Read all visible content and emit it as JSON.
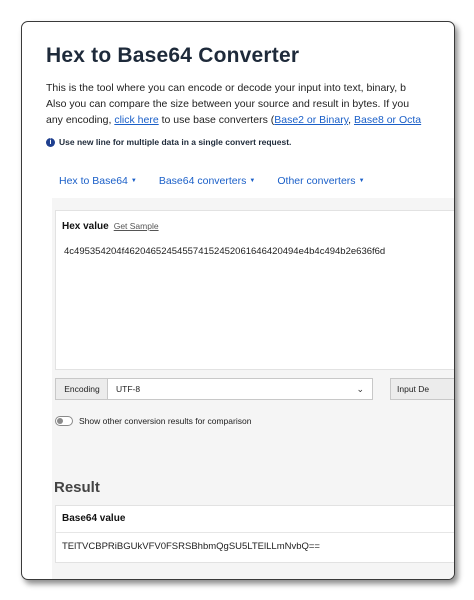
{
  "page": {
    "title": "Hex to Base64 Converter",
    "desc_line1": "This is the tool where you can encode or decode your input into text, binary, b",
    "desc_line2": "Also you can compare the size between your source and result in bytes. If you",
    "desc_line3_pre": "any encoding, ",
    "desc_link1": "click here",
    "desc_line3_mid": " to use base converters (",
    "desc_link2": "Base2 or Binary",
    "desc_sep": ", ",
    "desc_link3": "Base8 or Octa",
    "note": "Use new line for multiple data in a single convert request."
  },
  "nav": {
    "items": [
      "Hex to Base64",
      "Base64 converters",
      "Other converters"
    ]
  },
  "input": {
    "label": "Hex value",
    "sample_link": "Get Sample",
    "value": "4c495354204f462046524545574152452061646420494e4b4c494b2e636f6d"
  },
  "controls": {
    "encoding_label": "Encoding",
    "encoding_value": "UTF-8",
    "input_button": "Input De",
    "toggle_label": "Show other conversion results for comparison"
  },
  "result": {
    "title": "Result",
    "label": "Base64 value",
    "value": "TElTVCBPRiBGUkVFV0FSRSBhbmQgSU5LTElLLmNvbQ=="
  },
  "icons": {
    "info": "info-icon",
    "caret": "caret-down-icon",
    "chevron": "chevron-down-icon"
  },
  "colors": {
    "link": "#1a5fc8",
    "title": "#1e2a3a",
    "panel_bg": "#f5f5f5"
  }
}
